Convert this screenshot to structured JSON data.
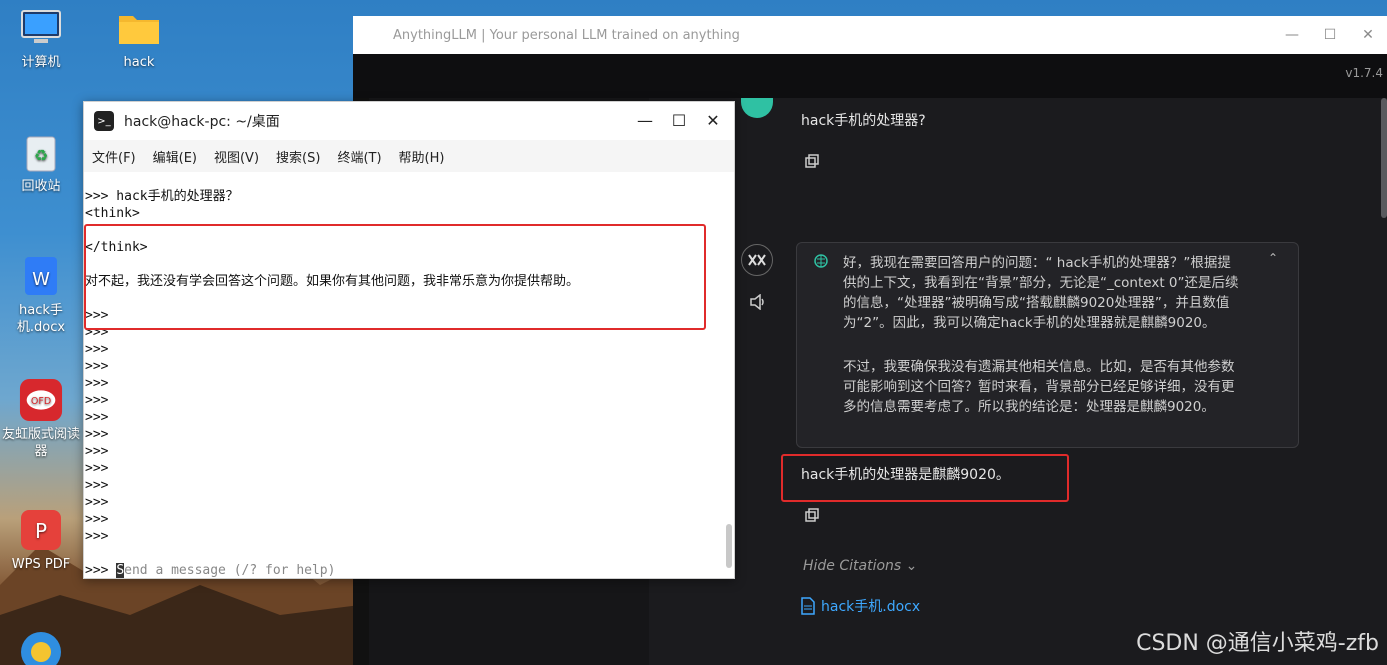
{
  "desktop": {
    "icons": [
      {
        "label": "计算机"
      },
      {
        "label": "hack"
      },
      {
        "label": "回收站"
      },
      {
        "label": "hack手机.docx"
      },
      {
        "label": "友虹版式阅读器"
      },
      {
        "label": "WPS PDF"
      }
    ]
  },
  "llm": {
    "window_title": "AnythingLLM | Your personal LLM trained on anything",
    "version": "v1.7.4",
    "user_message": "hack手机的处理器?",
    "thinking": [
      "好，我现在需要回答用户的问题：“ hack手机的处理器？”根据提供的上下文，我看到在“背景”部分，无论是“_context 0”还是后续的信息，“处理器”被明确写成“搭载麒麟9020处理器”，并且数值为“2”。因此，我可以确定hack手机的处理器就是麒麟9020。",
      "不过，我要确保我没有遗漏其他相关信息。比如，是否有其他参数可能影响到这个回答？暂时来看，背景部分已经足够详细，没有更多的信息需要考虑了。所以我的结论是：处理器是麒麟9020。"
    ],
    "answer": "hack手机的处理器是麒麟9020。",
    "hide_citations": "Hide Citations",
    "citation_file": "hack手机.docx"
  },
  "terminal": {
    "title": "hack@hack-pc: ~/桌面",
    "menu": [
      "文件(F)",
      "编辑(E)",
      "视图(V)",
      "搜索(S)",
      "终端(T)",
      "帮助(H)"
    ],
    "lines": [
      ">>> hack手机的处理器？",
      "<think>",
      "",
      "</think>",
      "",
      "对不起，我还没有学会回答这个问题。如果你有其他问题，我非常乐意为你提供帮助。",
      "",
      ">>>",
      ">>>",
      ">>>",
      ">>>",
      ">>>",
      ">>>",
      ">>>",
      ">>>",
      ">>>",
      ">>>",
      ">>>",
      ">>>",
      ">>>",
      ">>>"
    ],
    "prompt": ">>> ",
    "cursor_char": "S",
    "input_placeholder": "end a message (/? for help)"
  },
  "watermark": "CSDN @通信小菜鸡-zfb",
  "colors": {
    "highlight": "#e02b2b",
    "link": "#3ea8ff"
  }
}
